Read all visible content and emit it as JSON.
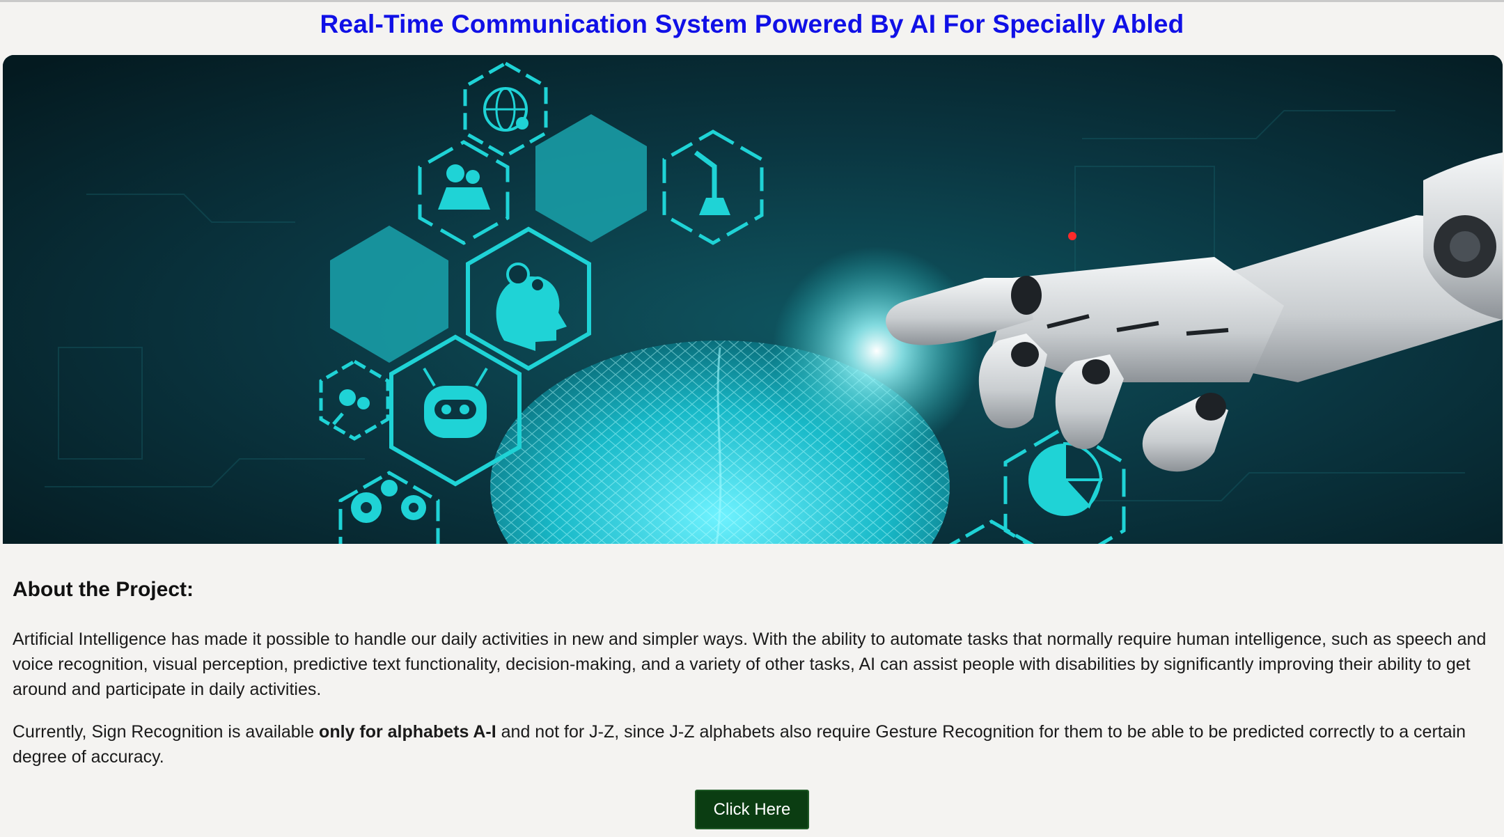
{
  "header": {
    "title": "Real-Time Communication System Powered By AI For Specially Abled"
  },
  "hero": {
    "icons": [
      "globe-icon",
      "gears-laptop-icon",
      "robot-arm-icon",
      "head-gears-icon",
      "robot-face-icon",
      "gears-search-icon",
      "gears-monitor-icon",
      "pie-chart-icon"
    ],
    "colors": {
      "background": "#06222a",
      "accent": "#1fd3d6",
      "glow": "#7ff6ff"
    }
  },
  "about": {
    "heading": "About the Project:",
    "paragraph1": "Artificial Intelligence has made it possible to handle our daily activities in new and simpler ways. With the ability to automate tasks that normally require human intelligence, such as speech and voice recognition, visual perception, predictive text functionality, decision-making, and a variety of other tasks, AI can assist people with disabilities by significantly improving their ability to get around and participate in daily activities.",
    "paragraph2_prefix": "Currently, Sign Recognition is available ",
    "paragraph2_bold": "only for alphabets A-I",
    "paragraph2_suffix": " and not for J-Z, since J-Z alphabets also require Gesture Recognition for them to be able to be predicted correctly to a certain degree of accuracy."
  },
  "cta": {
    "label": "Click Here"
  },
  "colors": {
    "title": "#1010e6",
    "button": "#0b3d12",
    "page_bg": "#f4f3f1"
  }
}
